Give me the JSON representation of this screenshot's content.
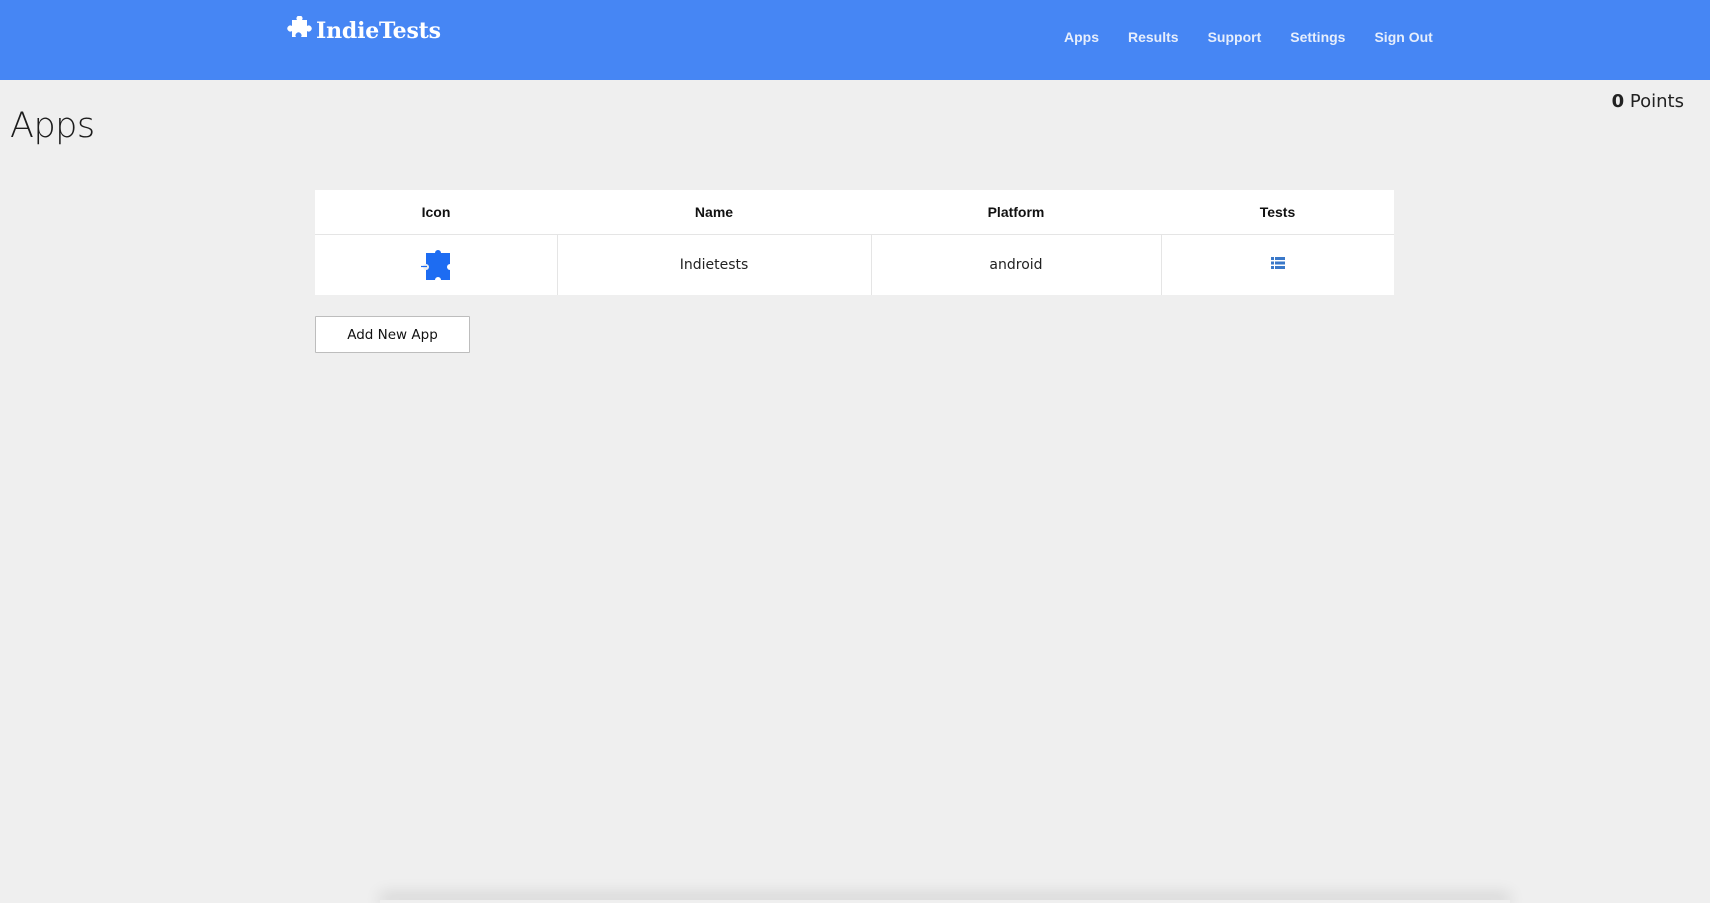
{
  "header": {
    "brand": "IndieTests",
    "nav": [
      {
        "label": "Apps"
      },
      {
        "label": "Results"
      },
      {
        "label": "Support"
      },
      {
        "label": "Settings"
      },
      {
        "label": "Sign Out"
      }
    ]
  },
  "page": {
    "title": "Apps",
    "points_value": "0",
    "points_label": "Points"
  },
  "table": {
    "columns": [
      "Icon",
      "Name",
      "Platform",
      "Tests"
    ],
    "rows": [
      {
        "icon": "puzzle-piece-icon",
        "name": "Indietests",
        "platform": "android",
        "tests_icon": "list-icon"
      }
    ]
  },
  "actions": {
    "add_app_label": "Add New App"
  },
  "colors": {
    "navbar": "#4686f4",
    "background": "#efefef",
    "app_icon": "#1d6cf2",
    "list_icon": "#3a78c9"
  }
}
